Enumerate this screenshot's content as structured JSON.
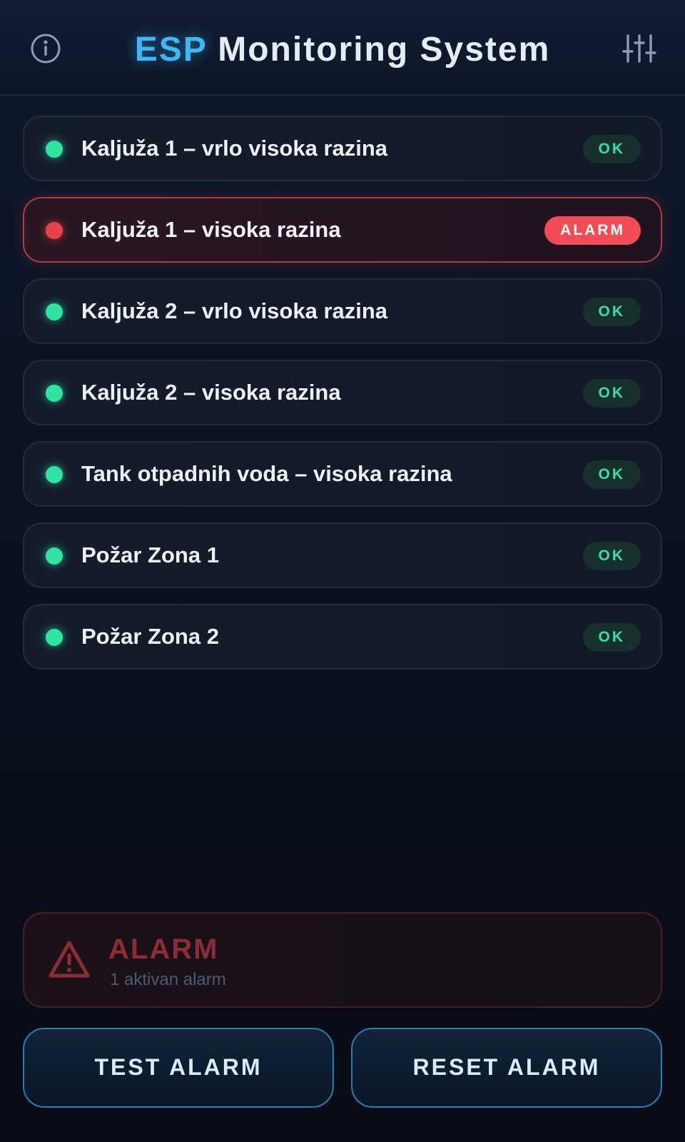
{
  "header": {
    "title_accent": "ESP",
    "title_rest": "Monitoring System",
    "info_icon": "info-icon",
    "settings_icon": "sliders-icon"
  },
  "sensors": [
    {
      "label": "Kaljuža 1 – vrlo visoka razina",
      "status": "OK",
      "state": "ok"
    },
    {
      "label": "Kaljuža 1 – visoka razina",
      "status": "ALARM",
      "state": "alarm"
    },
    {
      "label": "Kaljuža 2 – vrlo visoka razina",
      "status": "OK",
      "state": "ok"
    },
    {
      "label": "Kaljuža 2 – visoka razina",
      "status": "OK",
      "state": "ok"
    },
    {
      "label": "Tank otpadnih voda – visoka razina",
      "status": "OK",
      "state": "ok"
    },
    {
      "label": "Požar Zona 1",
      "status": "OK",
      "state": "ok"
    },
    {
      "label": "Požar Zona 2",
      "status": "OK",
      "state": "ok"
    }
  ],
  "alarm_panel": {
    "title": "ALARM",
    "subtitle": "1 aktivan alarm",
    "icon": "warning-triangle-icon"
  },
  "buttons": {
    "test": "TEST ALARM",
    "reset": "RESET ALARM"
  },
  "colors": {
    "accent": "#3db8f5",
    "ok": "#2fe3a0",
    "alarm": "#e5444c",
    "alarm_badge": "#f24d55",
    "button_border": "#2b7fb0"
  }
}
